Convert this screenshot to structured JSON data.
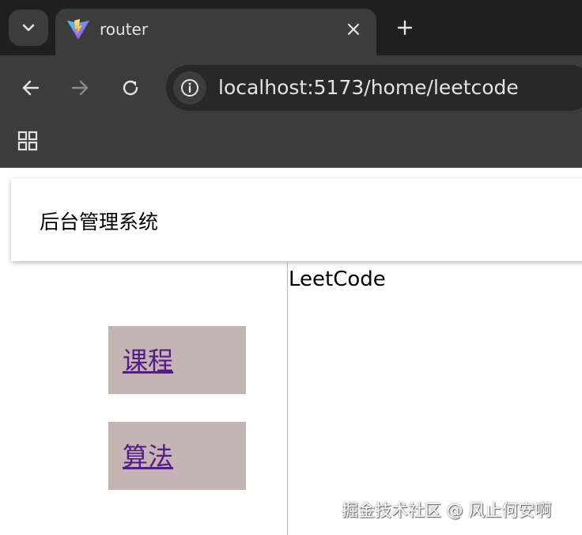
{
  "browser": {
    "tab": {
      "title": "router",
      "favicon": "vite-logo-icon"
    },
    "address_bar": {
      "url": "localhost:5173/home/leetcode"
    },
    "colors": {
      "tabstrip_bg": "#1f1f1f",
      "toolbar_bg": "#3c3c3c",
      "omnibox_bg": "#282828",
      "text": "#e3e3e3"
    }
  },
  "page": {
    "header": {
      "title": "后台管理系统"
    },
    "sidebar": {
      "items": [
        {
          "label": "课程"
        },
        {
          "label": "算法"
        }
      ],
      "item_bg": "#c4b4b4",
      "link_color": "#551a8b"
    },
    "content": {
      "text": "LeetCode"
    }
  },
  "watermark": {
    "text": "掘金技术社区 @ 风止何安啊"
  }
}
